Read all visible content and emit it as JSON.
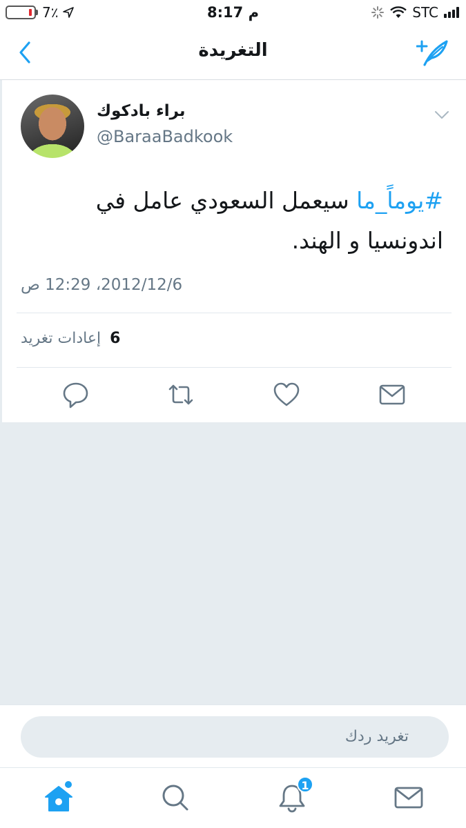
{
  "status_bar": {
    "battery_percent": "7٪",
    "time": "8:17 م",
    "carrier": "STC",
    "battery_level": 0.07
  },
  "nav": {
    "title": "التغريدة"
  },
  "tweet": {
    "author_name": "براء بادكوك",
    "author_handle": "@BaraaBadkook",
    "hashtag": "#يوماً_ما",
    "text": " سيعمل السعودي عامل في اندونسيا و الهند.",
    "timestamp": "2012/12/6، 12:29 ص",
    "retweet_count": "6",
    "retweet_label": "إعادات تغريد"
  },
  "reply": {
    "placeholder": "تغريد ردك"
  },
  "tab_bar": {
    "notifications_badge": "1"
  },
  "colors": {
    "accent": "#1da1f2",
    "secondary_text": "#657786",
    "divider": "#e1e8ed",
    "background_gray": "#e6ecf0"
  }
}
